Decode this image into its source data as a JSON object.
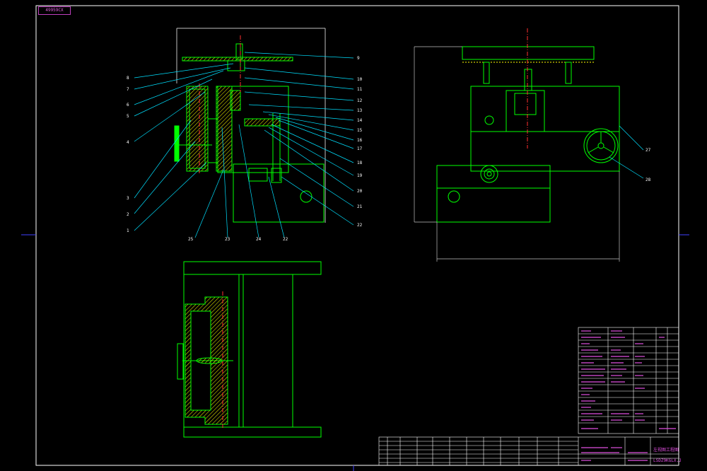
{
  "drawing_code": "49959CX",
  "titleblock": {
    "title_label": "左视图工程图",
    "drawing_number": "LSDZ9KGLX.J"
  },
  "balloons_left": [
    "8",
    "7",
    "6",
    "5",
    "4",
    "3",
    "2",
    "1"
  ],
  "balloons_right": [
    "9",
    "10",
    "11",
    "12",
    "13",
    "14",
    "15",
    "16",
    "17",
    "18",
    "19",
    "20",
    "21",
    "22"
  ],
  "balloons_bottom": [
    "25",
    "23",
    "24",
    "22"
  ],
  "balloons_side": [
    "27",
    "28"
  ],
  "colors": {
    "border": "#ffffff",
    "geometry": "#00ff00",
    "hatch": "#ffff00",
    "centerline": "#ff3030",
    "leader": "#00e0ff",
    "titleblock": "#ffffff",
    "titletext": "#e050e0"
  }
}
